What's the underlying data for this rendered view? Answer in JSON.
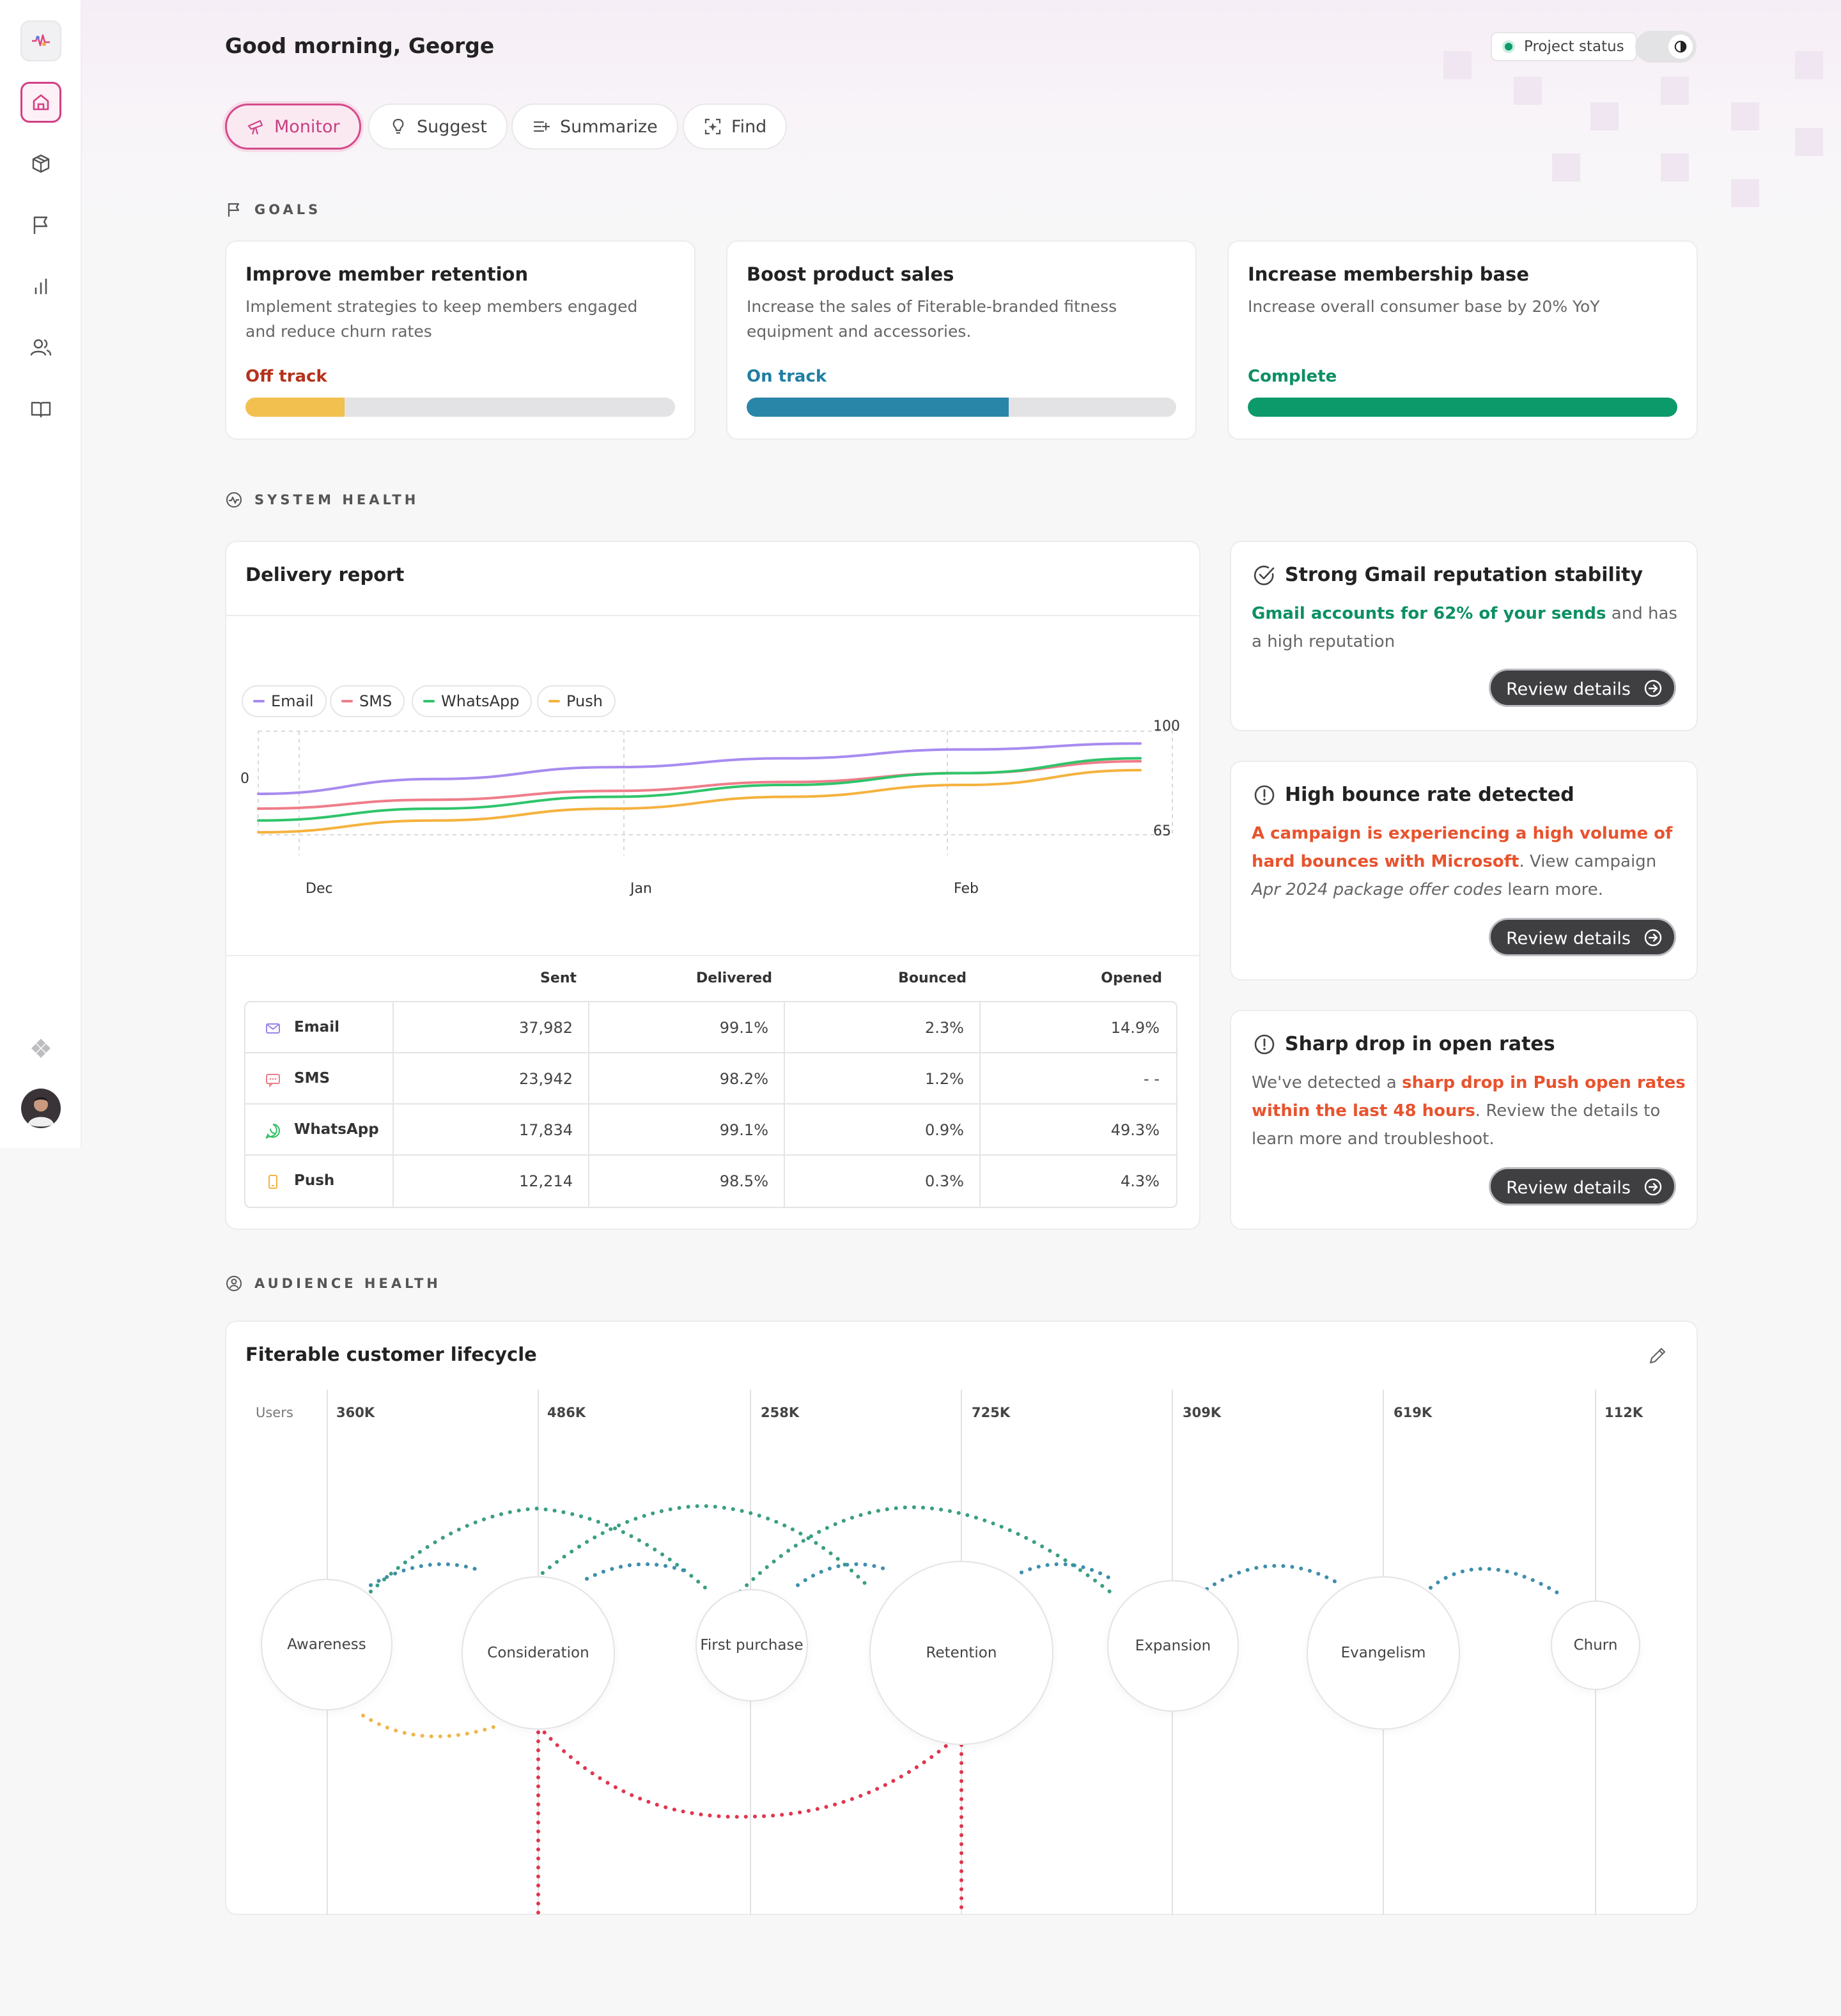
{
  "greeting": "Good morning, George",
  "project_status": "Project status",
  "actions": [
    "Monitor",
    "Suggest",
    "Summarize",
    "Find"
  ],
  "sections": {
    "goals": "GOALS",
    "system_health": "SYSTEM HEALTH",
    "audience_health": "AUDIENCE HEALTH"
  },
  "goals": [
    {
      "title": "Improve member retention",
      "desc": "Implement strategies to keep members engaged and reduce churn rates",
      "status": "Off track",
      "progress": 0.23,
      "color": "#f2c04f",
      "status_color": "#b4321c"
    },
    {
      "title": "Boost product sales",
      "desc": "Increase the sales of Fiterable-branded fitness equipment and accessories.",
      "status": "On track",
      "progress": 0.61,
      "color": "#2a86a8",
      "status_color": "#1f7ea4"
    },
    {
      "title": "Increase membership base",
      "desc": "Increase overall consumer base by 20% YoY",
      "status": "Complete",
      "progress": 1.0,
      "color": "#0c9a6b",
      "status_color": "#0c8f62"
    }
  ],
  "delivery": {
    "title": "Delivery report",
    "legend": [
      "Email",
      "SMS",
      "WhatsApp",
      "Push"
    ],
    "y_left": "0",
    "y_top": "100",
    "y_mid": "65",
    "x_labels": [
      "Dec",
      "Jan",
      "Feb"
    ],
    "headers": [
      "Sent",
      "Delivered",
      "Bounced",
      "Opened"
    ],
    "rows": [
      {
        "name": "Email",
        "sent": "37,982",
        "delivered": "99.1%",
        "bounced": "2.3%",
        "opened": "14.9%"
      },
      {
        "name": "SMS",
        "sent": "23,942",
        "delivered": "98.2%",
        "bounced": "1.2%",
        "opened": "- -"
      },
      {
        "name": "WhatsApp",
        "sent": "17,834",
        "delivered": "99.1%",
        "bounced": "0.9%",
        "opened": "49.3%"
      },
      {
        "name": "Push",
        "sent": "12,214",
        "delivered": "98.5%",
        "bounced": "0.3%",
        "opened": "4.3%"
      }
    ]
  },
  "chart_data": {
    "type": "line",
    "x": [
      "Dec",
      "Jan",
      "Feb"
    ],
    "series": [
      {
        "name": "Email",
        "color": "#a78bf0",
        "values": [
          81,
          86,
          90,
          93,
          96,
          98
        ]
      },
      {
        "name": "SMS",
        "color": "#ef7d8a",
        "values": [
          76,
          79,
          82,
          85,
          88,
          92
        ]
      },
      {
        "name": "WhatsApp",
        "color": "#2fc46a",
        "values": [
          72,
          76,
          80,
          84,
          88,
          93
        ]
      },
      {
        "name": "Push",
        "color": "#f5b23e",
        "values": [
          68,
          72,
          76,
          80,
          84,
          89
        ]
      }
    ],
    "y_labels": [
      "100",
      "65"
    ]
  },
  "insights": [
    {
      "title": "Strong Gmail reputation stability",
      "highlight": "Gmail accounts for 62% of your sends",
      "rest": " and has a high reputation",
      "button": "Review details"
    },
    {
      "title": "High bounce rate detected",
      "highlight": "A campaign is experiencing a high volume of hard bounces with Microsoft",
      "mid": ". View campaign ",
      "italic": "Apr 2024 package offer codes",
      "rest": " learn more.",
      "button": "Review details"
    },
    {
      "title": "Sharp drop in open rates",
      "pre": "We've detected a ",
      "highlight": "sharp drop in Push open rates within the last 48 hours",
      "rest": ". Review the details to learn more and troubleshoot.",
      "button": "Review details"
    }
  ],
  "lifecycle": {
    "title": "Fiterable customer lifecycle",
    "users_label": "Users",
    "stages": [
      {
        "name": "Awareness",
        "users": "360K"
      },
      {
        "name": "Consideration",
        "users": "486K"
      },
      {
        "name": "First purchase",
        "users": "258K"
      },
      {
        "name": "Retention",
        "users": "725K"
      },
      {
        "name": "Expansion",
        "users": "309K"
      },
      {
        "name": "Evangelism",
        "users": "619K"
      },
      {
        "name": "Churn",
        "users": "112K"
      }
    ]
  }
}
